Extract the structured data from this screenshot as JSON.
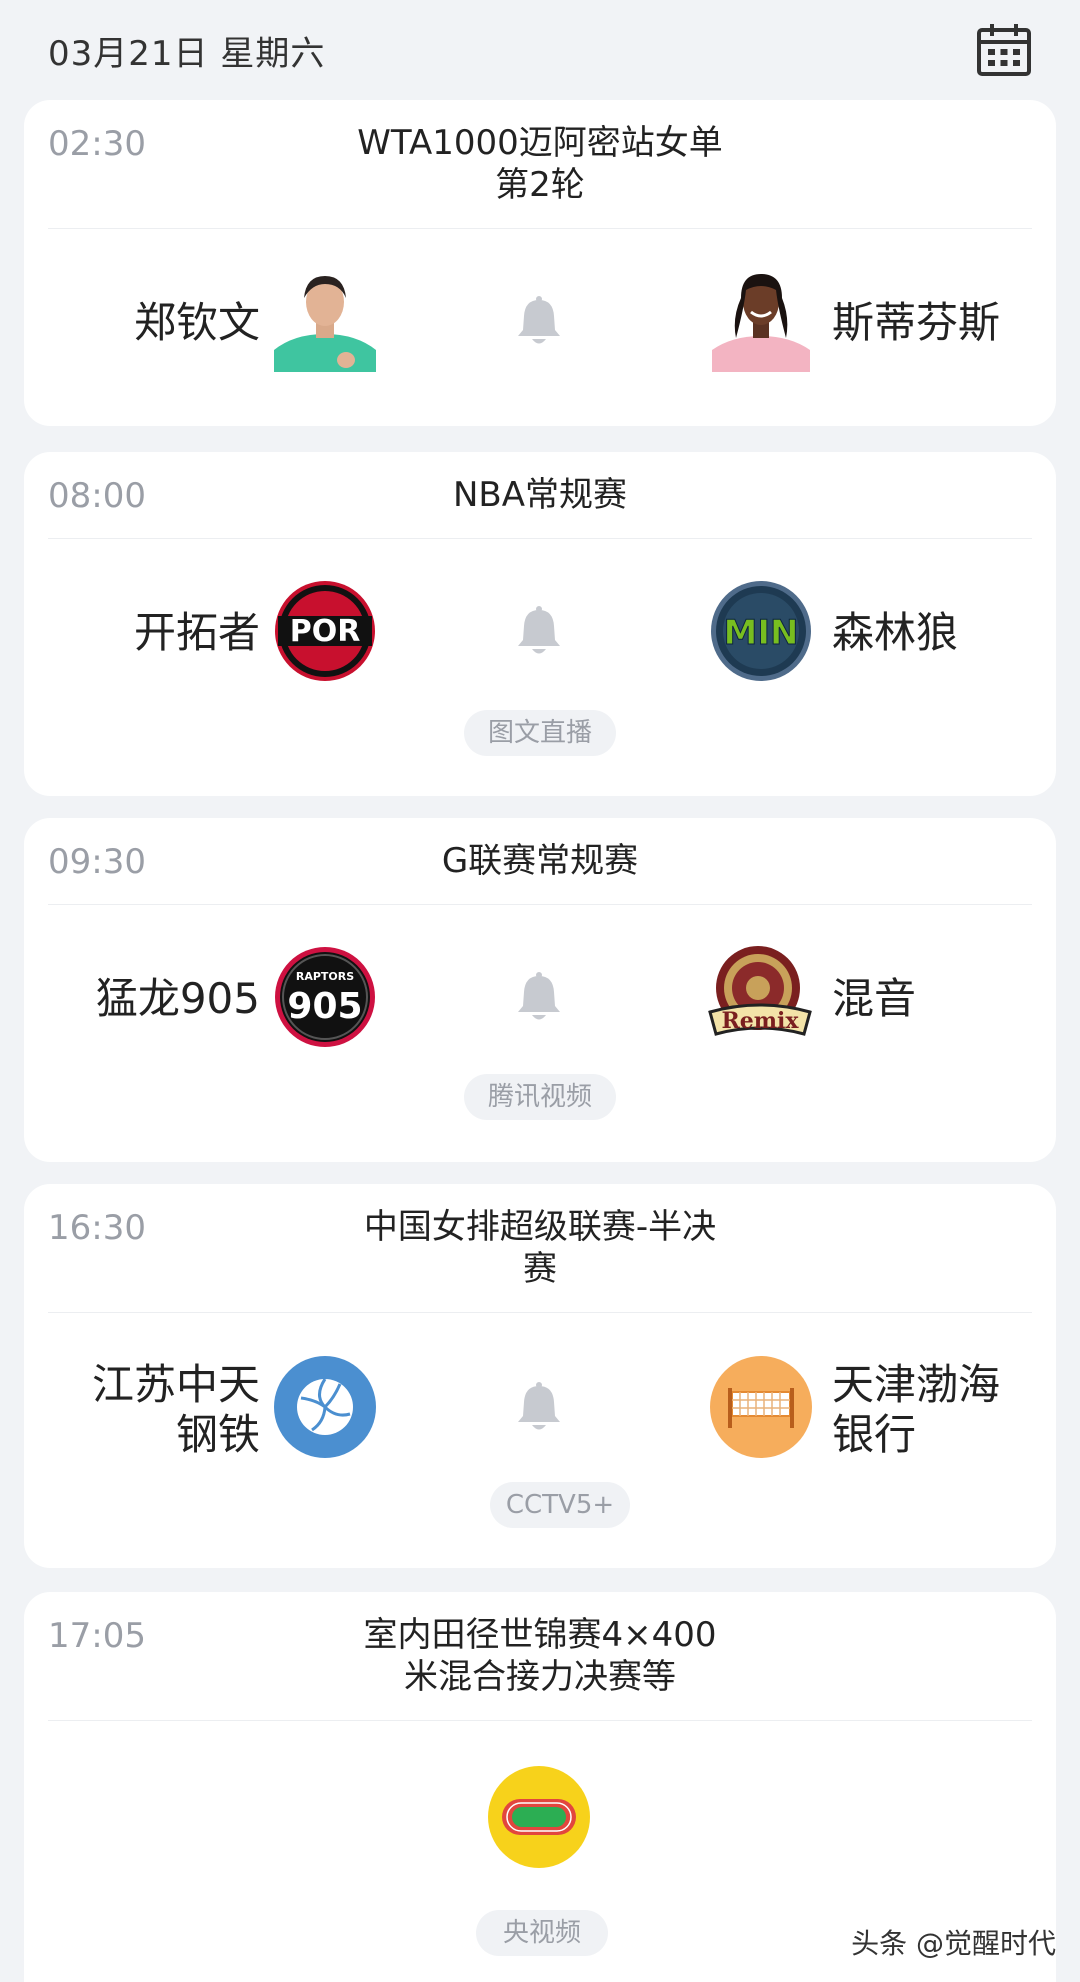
{
  "header": {
    "date": "03月21日 星期六",
    "calendar_icon": "calendar-icon"
  },
  "matches": [
    {
      "time": "02:30",
      "title_line1": "WTA1000迈阿密站女单",
      "title_line2": "第2轮",
      "home": "郑钦文",
      "away": "斯蒂芬斯",
      "channel": ""
    },
    {
      "time": "08:00",
      "title_line1": "NBA常规赛",
      "home": "开拓者",
      "home_logo_text": "POR",
      "away": "森林狼",
      "away_logo_text": "MIN",
      "channel": "图文直播"
    },
    {
      "time": "09:30",
      "title_line1": "G联赛常规赛",
      "home": "猛龙905",
      "home_logo_text": "905",
      "home_logo_sub": "RAPTORS",
      "away": "混音",
      "away_logo_text": "Remix",
      "channel": "腾讯视频"
    },
    {
      "time": "16:30",
      "title_line1": "中国女排超级联赛-半决",
      "title_line2": "赛",
      "home_line1": "江苏中天",
      "home_line2": "钢铁",
      "away_line1": "天津渤海",
      "away_line2": "银行",
      "channel": "CCTV5+"
    },
    {
      "time": "17:05",
      "title_line1": "室内田径世锦赛4×400",
      "title_line2": "米混合接力决赛等",
      "channel": "央视频"
    }
  ],
  "watermark": "头条 @觉醒时代",
  "colors": {
    "background": "#f1f3f6",
    "card": "#ffffff",
    "muted": "#9a9ea6",
    "bell": "#c7cad0"
  }
}
